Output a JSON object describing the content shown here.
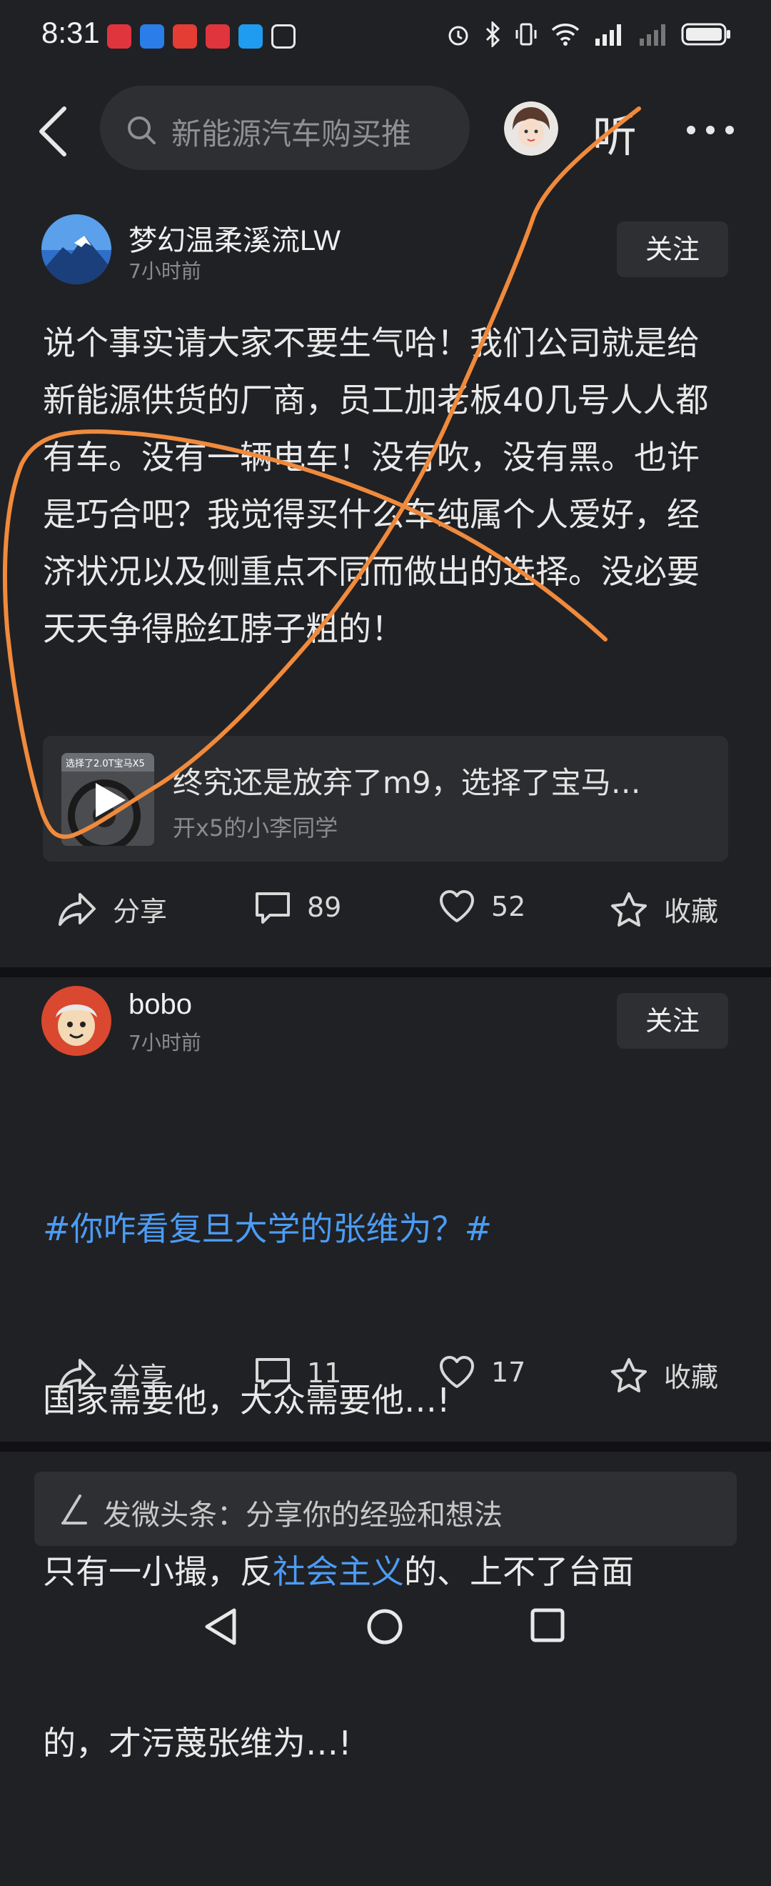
{
  "status_bar": {
    "time": "8:31",
    "notification_icons": [
      "xiaohongshu-icon",
      "browser-icon",
      "toutiao-icon",
      "xiaohongshu-icon",
      "search-app-icon",
      "nfc-icon"
    ],
    "system_icons": [
      "alarm-icon",
      "bluetooth-icon",
      "vibrate-icon",
      "wifi-icon",
      "4g-signal-icon",
      "signal-icon",
      "battery-icon"
    ]
  },
  "header": {
    "search_placeholder": "新能源汽车购买推",
    "listen_label": "听"
  },
  "posts": [
    {
      "author": "梦幻温柔溪流LW",
      "time": "7小时前",
      "follow_label": "关注",
      "body": "说个事实请大家不要生气哈！我们公司就是给新能源供货的厂商，员工加老板40几号人人都有车。没有一辆电车！没有吹，没有黑。也许是巧合吧？我觉得买什么车纯属个人爱好，经济状况以及侧重点不同而做出的选择。没必要天天争得脸红脖子粗的！",
      "repost": {
        "thumb_caption": "选择了2.0T宝马X5",
        "title": "终究还是放弃了m9，选择了宝马…",
        "source": "开x5的小李同学"
      },
      "actions": {
        "share": "分享",
        "comments": "89",
        "likes": "52",
        "favorite": "收藏"
      }
    },
    {
      "author": "bobo",
      "time": "7小时前",
      "follow_label": "关注",
      "hashtag": "#你咋看复旦大学的张维为？#",
      "line1": "国家需要他，大众需要他…!",
      "line2_prefix": "只有一小撮，反",
      "line2_link": "社会主义",
      "line2_suffix": "的、上不了台面",
      "line3": "的，才污蔑张维为…!",
      "actions": {
        "share": "分享",
        "comments": "11",
        "likes": "17",
        "favorite": "收藏"
      }
    }
  ],
  "composer": {
    "placeholder": "发微头条：分享你的经验和想法"
  },
  "colors": {
    "background": "#202124",
    "accent_link": "#4b9cf5",
    "annotation": "#f08a3c"
  }
}
